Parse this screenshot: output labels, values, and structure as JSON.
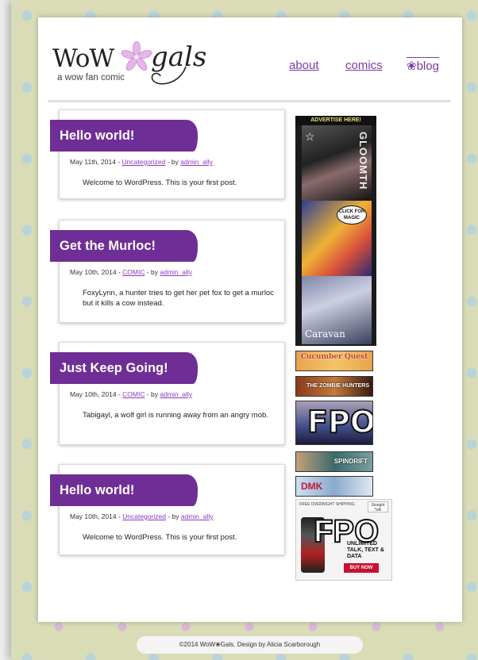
{
  "brand": {
    "logo_main": "WoW",
    "logo_script": "gals",
    "tagline": "a wow fan comic",
    "accent_color": "#6f2e95",
    "link_color": "#8a3bbd",
    "flower_icon": "flower-icon"
  },
  "nav": {
    "about": "about",
    "comics": "comics",
    "blog": "blog",
    "blog_icon": "❀"
  },
  "posts": [
    {
      "title": "Hello world!",
      "date": "May 11th, 2014 - ",
      "category": "Uncategorized",
      "by": " - by ",
      "author": "admin_ally",
      "body": "Welcome to WordPress. This is your first post."
    },
    {
      "title": "Get the Murloc!",
      "date": "May 10th, 2014 - ",
      "category": "COMIC",
      "by": " - by ",
      "author": "admin_ally",
      "body": "FoxyLynn, a hunter tries to get her pet fox to get a murloc but it kills a cow instead."
    },
    {
      "title": "Just Keep Going!",
      "date": "May 10th, 2014 - ",
      "category": "COMIC",
      "by": " - by ",
      "author": "admin_ally",
      "body": "Tabigayl, a wolf girl is running away from an angry mob."
    },
    {
      "title": "Hello world!",
      "date": "May 10th, 2014 - ",
      "category": "Uncategorized",
      "by": " - by ",
      "author": "admin_ally",
      "body": "Welcome to WordPress. This is your first post."
    }
  ],
  "ads": {
    "header": "ADVERTISE HERE!",
    "gloom": "GLOOMTH",
    "magic": "CLICK FOR MAGIC",
    "caravan": "Caravan",
    "cucumber": "Cucumber Quest",
    "zombie": "THE ZOMBIE HUNTERS",
    "fpo": "FPO",
    "spindrift": "SPINDRIFT",
    "dmk": "DMK",
    "phone_top": "FREE OVERNIGHT SHIPPING",
    "phone_brand": "Straight Talk",
    "phone_unlimited": "UNLIMITED TALK, TEXT & DATA",
    "phone_buy": "BUY NOW"
  },
  "footer": {
    "text": "©2014 WoW❀Gals. Design by Alicia Scarborough"
  }
}
